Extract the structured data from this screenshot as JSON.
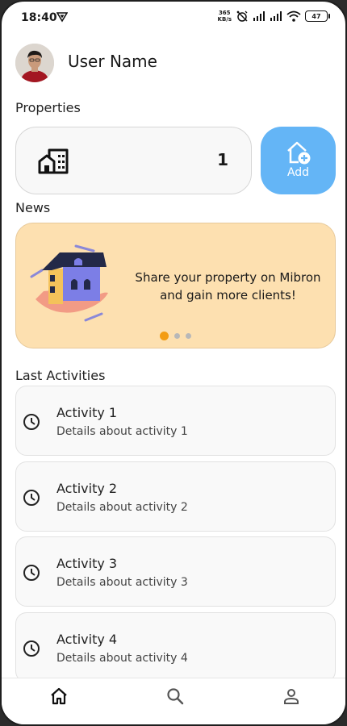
{
  "status_bar": {
    "time": "18:40",
    "network_speed_value": "365",
    "network_speed_unit": "KB/s",
    "battery_level": "47"
  },
  "header": {
    "user_name": "User Name"
  },
  "properties": {
    "section_title": "Properties",
    "count": "1",
    "add_label": "Add"
  },
  "news": {
    "section_title": "News",
    "text": "Share your property on Mibron and gain more clients!",
    "slide_count": 3,
    "active_slide": 1
  },
  "activities": {
    "section_title": "Last Activities",
    "items": [
      {
        "title": "Activity 1",
        "details": "Details about activity 1"
      },
      {
        "title": "Activity 2",
        "details": "Details about activity 2"
      },
      {
        "title": "Activity 3",
        "details": "Details about activity 3"
      },
      {
        "title": "Activity 4",
        "details": "Details about activity 4"
      }
    ]
  },
  "bottom_nav": {
    "items": [
      {
        "icon": "home-icon",
        "active": true
      },
      {
        "icon": "search-icon",
        "active": false
      },
      {
        "icon": "profile-icon",
        "active": false
      }
    ]
  },
  "colors": {
    "accent_blue": "#64b5f6",
    "news_background": "#fde0b0",
    "active_dot": "#f39c12"
  }
}
